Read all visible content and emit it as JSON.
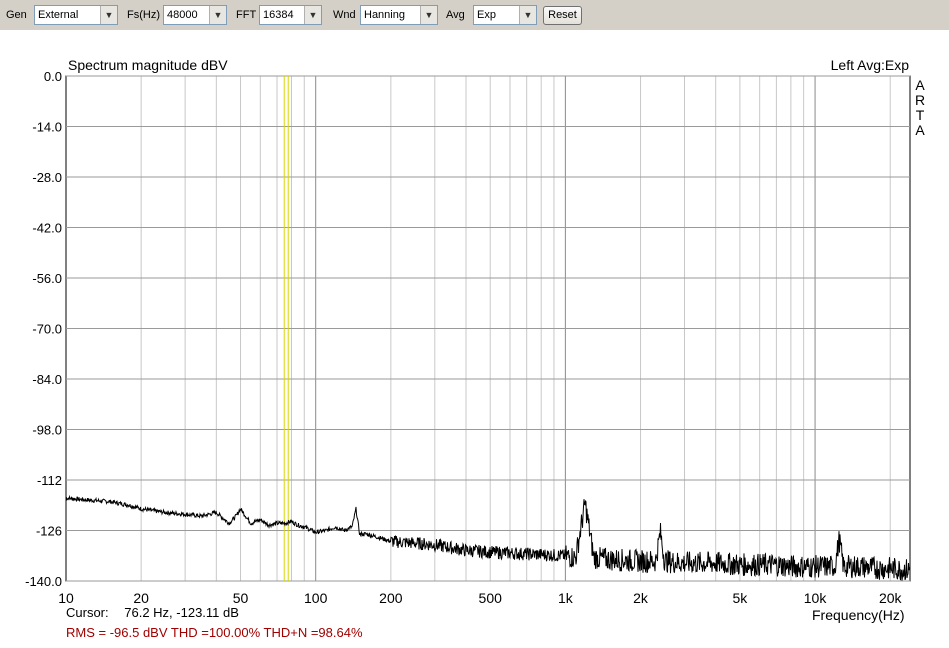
{
  "toolbar": {
    "gen_label": "Gen",
    "gen_value": "External",
    "fs_label": "Fs(Hz)",
    "fs_value": "48000",
    "fft_label": "FFT",
    "fft_value": "16384",
    "wnd_label": "Wnd",
    "wnd_value": "Hanning",
    "avg_label": "Avg",
    "avg_value": "Exp",
    "reset_label": "Reset"
  },
  "chart_data": {
    "type": "line",
    "title": "Spectrum magnitude dBV",
    "channel_label": "Left  Avg:Exp",
    "brand": "ARTA",
    "xlabel": "Frequency(Hz)",
    "x_scale": "log",
    "xlim": [
      10,
      24000
    ],
    "ylim": [
      -140,
      0
    ],
    "y_ticks": [
      "0.0",
      "-14.0",
      "-28.0",
      "-42.0",
      "-56.0",
      "-70.0",
      "-84.0",
      "-98.0",
      "-112",
      "-126",
      "-140.0"
    ],
    "x_ticks": [
      "10",
      "20",
      "50",
      "100",
      "200",
      "500",
      "1k",
      "2k",
      "5k",
      "10k",
      "20k"
    ],
    "grid": true,
    "series": [
      {
        "color": "#000000",
        "x": [
          10,
          12,
          15,
          18,
          20,
          25,
          30,
          35,
          40,
          45,
          48,
          50,
          55,
          60,
          65,
          70,
          75,
          80,
          85,
          90,
          100,
          110,
          120,
          130,
          140,
          145,
          150,
          160,
          180,
          200,
          250,
          300,
          400,
          500,
          700,
          1000,
          1100,
          1200,
          1300,
          1500,
          2000,
          2300,
          2400,
          2500,
          3000,
          3500,
          4000,
          5000,
          6000,
          7000,
          8000,
          10000,
          12000,
          12500,
          13000,
          15000,
          18000,
          20000,
          24000
        ],
        "y": [
          -117,
          -117.5,
          -118,
          -119,
          -120,
          -121,
          -121.5,
          -122,
          -121,
          -124,
          -122,
          -120,
          -124,
          -123,
          -124.5,
          -124,
          -124,
          -123.5,
          -124.5,
          -125,
          -126.5,
          -126,
          -125,
          -126,
          -125,
          -120,
          -127,
          -127,
          -128,
          -129,
          -129.5,
          -130,
          -131.5,
          -132,
          -132.5,
          -133,
          -133.5,
          -118.5,
          -133.5,
          -134,
          -134.5,
          -134.5,
          -126.5,
          -134.5,
          -135,
          -135,
          -135,
          -135.5,
          -135.5,
          -135.5,
          -136,
          -136,
          -136,
          -128.5,
          -136,
          -136,
          -136.5,
          -136.5,
          -137
        ]
      }
    ],
    "cursor": {
      "freq_hz": 76.2,
      "color": "#d8d800"
    }
  },
  "status": {
    "cursor_label": "Cursor:",
    "cursor_text": "76.2 Hz, -123.11 dB",
    "rms_text": "RMS =  -96.5 dBV   THD =100.00%   THD+N =98.64%",
    "rms_color": "#a00000"
  }
}
